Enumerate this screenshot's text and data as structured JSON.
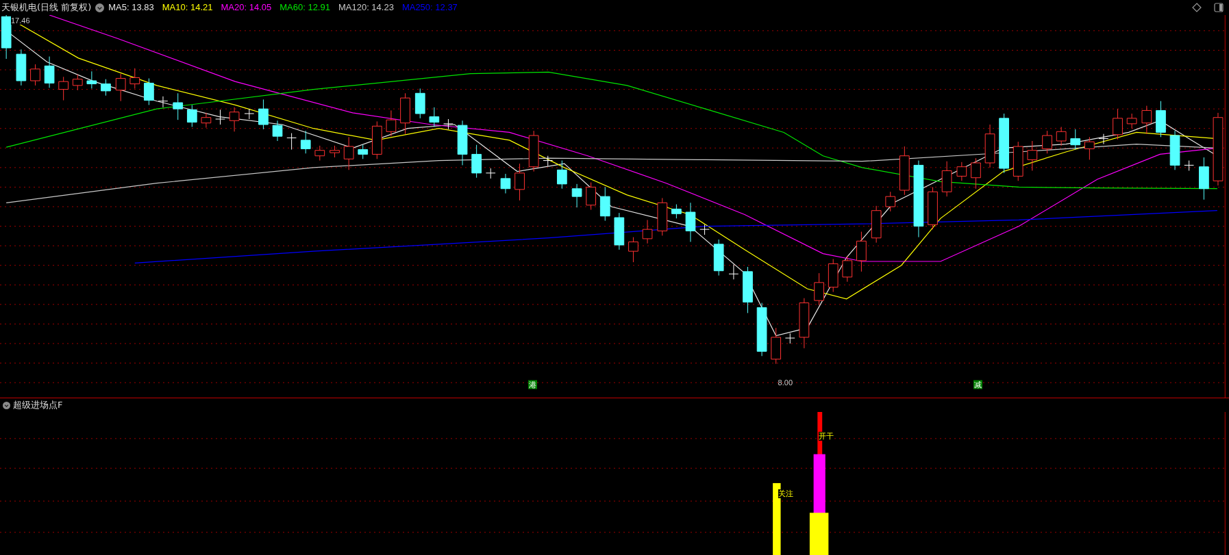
{
  "header": {
    "title": "天银机电(日线 前复权)",
    "ma_values": [
      {
        "label": "MA5: 13.83",
        "color": "#e6e6e6"
      },
      {
        "label": "MA10: 14.21",
        "color": "#ffff00"
      },
      {
        "label": "MA20: 14.05",
        "color": "#ff00ff"
      },
      {
        "label": "MA60: 12.91",
        "color": "#00e600"
      },
      {
        "label": "MA120: 14.23",
        "color": "#c8c8c8"
      },
      {
        "label": "MA250: 12.37",
        "color": "#0000ff"
      }
    ]
  },
  "price_chart": {
    "high_label": "17.46",
    "low_label": "8.00",
    "signal_tags": [
      {
        "text": "港"
      },
      {
        "text": "减"
      }
    ]
  },
  "indicator": {
    "name": "超级进场点F",
    "signals": [
      {
        "text": "关注"
      },
      {
        "text": "开干"
      }
    ]
  }
}
